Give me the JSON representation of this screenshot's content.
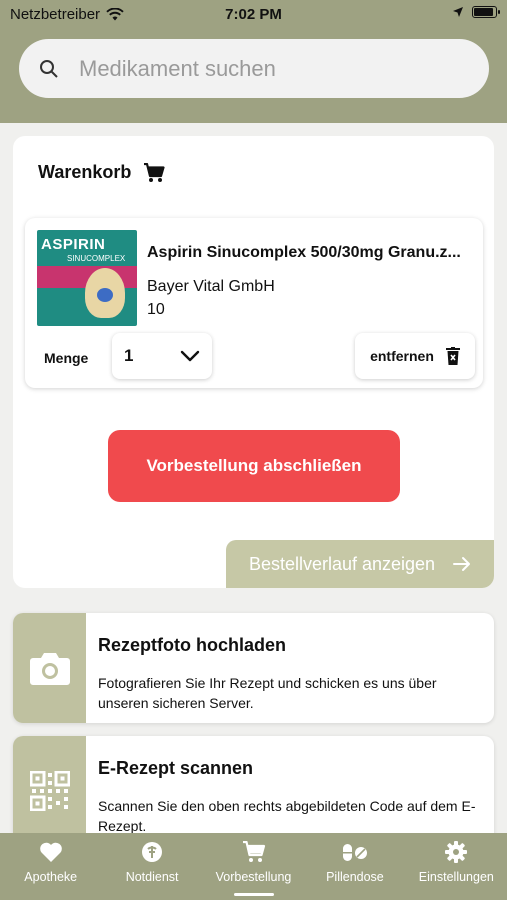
{
  "status_bar": {
    "carrier": "Netzbetreiber",
    "time": "7:02 PM"
  },
  "search": {
    "placeholder": "Medikament suchen"
  },
  "cart": {
    "title": "Warenkorb",
    "item": {
      "name": "Aspirin Sinucomplex 500/30mg Granu.z...",
      "manufacturer": "Bayer Vital GmbH",
      "package_size": "10",
      "image_brand": "ASPIRIN",
      "image_sub": "SINUCOMPLEX",
      "quantity_label": "Menge",
      "quantity_value": "1",
      "remove_label": "entfernen"
    },
    "order_button": "Vorbestellung abschließen",
    "history_button": "Bestellverlauf anzeigen"
  },
  "features": [
    {
      "title": "Rezeptfoto hochladen",
      "text": "Fotografieren Sie Ihr Rezept und schicken es uns über unseren sicheren Server."
    },
    {
      "title": "E-Rezept scannen",
      "text": "Scannen Sie den oben rechts abgebildeten Code auf dem E-Rezept."
    }
  ],
  "nav": [
    {
      "label": "Apotheke",
      "icon": "heart-icon"
    },
    {
      "label": "Notdienst",
      "icon": "notdienst-icon"
    },
    {
      "label": "Vorbestellung",
      "icon": "cart-icon"
    },
    {
      "label": "Pillendose",
      "icon": "pill-icon"
    },
    {
      "label": "Einstellungen",
      "icon": "gear-icon"
    }
  ],
  "colors": {
    "header": "#9ea282",
    "accent_light": "#c6c8a6",
    "order_button": "#f04a4d"
  }
}
